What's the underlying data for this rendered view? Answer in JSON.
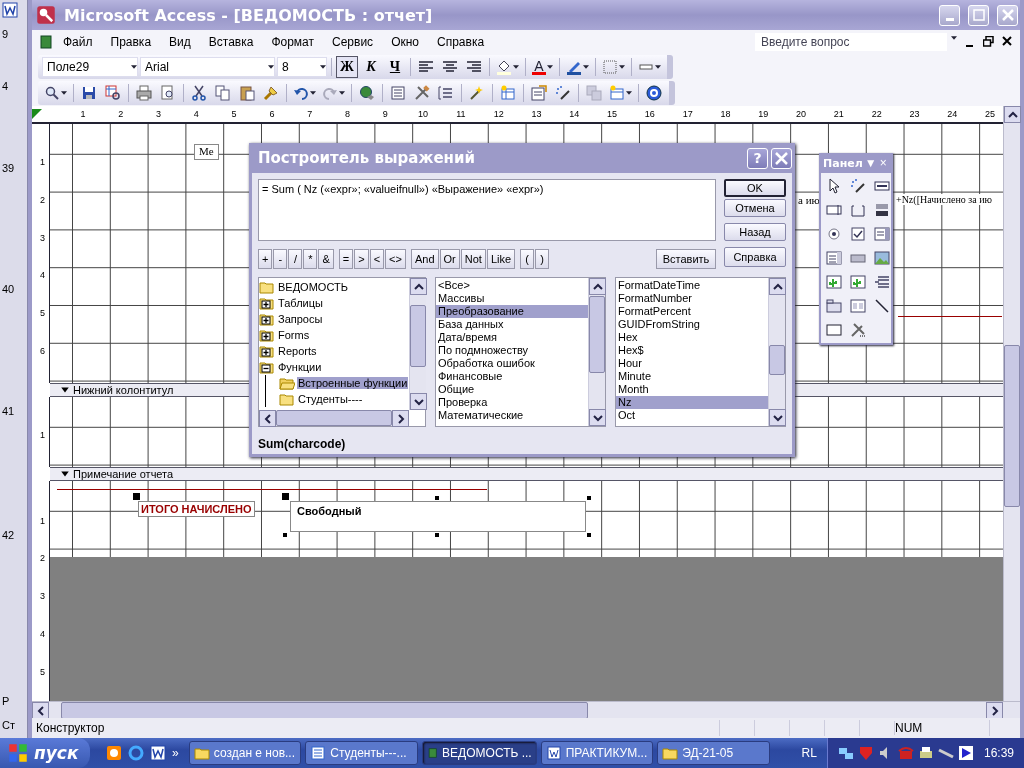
{
  "window": {
    "title": "Microsoft Access - [ВЕДОМОСТЬ : отчет]"
  },
  "menu": [
    "Файл",
    "Правка",
    "Вид",
    "Вставка",
    "Формат",
    "Сервис",
    "Окно",
    "Справка"
  ],
  "help_search": {
    "placeholder": "Введите вопрос"
  },
  "format_toolbar": {
    "control": "Поле29",
    "font": "Arial",
    "size": "8",
    "bold": {
      "label": "Ж",
      "on": true
    },
    "italic": "К",
    "underline": "Ч",
    "font_color": "A"
  },
  "ruler": [
    "1",
    "2",
    "3",
    "4",
    "5",
    "6",
    "7",
    "8",
    "9",
    "10",
    "11",
    "12",
    "13",
    "14",
    "15",
    "16",
    "17",
    "18",
    "19",
    "20",
    "21",
    "22",
    "23",
    "24",
    "25"
  ],
  "detail": {
    "ruler": [
      "1",
      "2",
      "3",
      "4",
      "5",
      "6"
    ],
    "label": "Ме",
    "text_1": "а ию",
    "text_2": "+Nz([Начислено за ию"
  },
  "page_footer": {
    "title": "Нижний колонтитул",
    "ruler": [
      "1"
    ]
  },
  "report_footer": {
    "title": "Примечание отчета",
    "ruler": [
      "1",
      "2",
      "3",
      "4",
      "5"
    ],
    "label": "ИТОГО НАЧИСЛЕНО",
    "textbox": "Свободный"
  },
  "dialog": {
    "title": "Построитель выражений",
    "help": "?",
    "expression": "= Sum ( Nz («expr»; «valueifnull») «Выражение» «expr»)",
    "buttons": [
      "OK",
      "Отмена",
      "Назад",
      "Справка"
    ],
    "insert": "Вставить",
    "operators": [
      "+",
      "-",
      "/",
      "*",
      "&",
      "=",
      ">",
      "<",
      "<>",
      "And",
      "Or",
      "Not",
      "Like",
      "(",
      ")"
    ],
    "tree": [
      {
        "label": "ВЕДОМОСТЬ",
        "selected": false
      },
      {
        "label": "Таблицы",
        "expanded": false,
        "selected": false
      },
      {
        "label": "Запросы",
        "expanded": false,
        "selected": false
      },
      {
        "label": "Forms",
        "expanded": false,
        "selected": false
      },
      {
        "label": "Reports",
        "expanded": false,
        "selected": false
      },
      {
        "label": "Функции",
        "expanded": true,
        "selected": false,
        "children": [
          {
            "label": "Встроенные функции",
            "selected": true
          },
          {
            "label": "Студенты----",
            "selected": false
          }
        ]
      }
    ],
    "categories": [
      {
        "label": "<Все>",
        "selected": false
      },
      {
        "label": "Массивы",
        "selected": false
      },
      {
        "label": "Преобразование",
        "selected": true
      },
      {
        "label": "База данных",
        "selected": false
      },
      {
        "label": "Дата/время",
        "selected": false
      },
      {
        "label": "По подмножеству",
        "selected": false
      },
      {
        "label": "Обработка ошибок",
        "selected": false
      },
      {
        "label": "Финансовые",
        "selected": false
      },
      {
        "label": "Общие",
        "selected": false
      },
      {
        "label": "Проверка",
        "selected": false
      },
      {
        "label": "Математические",
        "selected": false
      }
    ],
    "functions": [
      {
        "label": "FormatDateTime",
        "selected": false
      },
      {
        "label": "FormatNumber",
        "selected": false
      },
      {
        "label": "FormatPercent",
        "selected": false
      },
      {
        "label": "GUIDFromString",
        "selected": false
      },
      {
        "label": "Hex",
        "selected": false
      },
      {
        "label": "Hex$",
        "selected": false
      },
      {
        "label": "Hour",
        "selected": false
      },
      {
        "label": "Minute",
        "selected": false
      },
      {
        "label": "Month",
        "selected": false
      },
      {
        "label": "Nz",
        "selected": true
      },
      {
        "label": "Oct",
        "selected": false
      }
    ],
    "syntax": "Sum(charcode)"
  },
  "toolbox": {
    "title": "Панел",
    "menu": "▼",
    "close": "×"
  },
  "status_bar": {
    "mode": "Конструктор",
    "num": "NUM"
  },
  "taskbar": {
    "start": "пуск",
    "more": "»",
    "tasks": [
      {
        "label": "создан е нов...",
        "kind": "folder",
        "selected": false
      },
      {
        "label": "Студенты---...",
        "kind": "form",
        "selected": false
      },
      {
        "label": "ВЕДОМОСТЬ ...",
        "kind": "access",
        "selected": true
      },
      {
        "label": "ПРАКТИКУМ...",
        "kind": "word",
        "selected": false
      },
      {
        "label": "ЭД-21-05",
        "kind": "folder",
        "selected": false
      }
    ],
    "language": "RL",
    "time": "16:39"
  },
  "background_window": {
    "texts": [
      "9",
      "4",
      "39",
      "40",
      "41",
      "42",
      "Р",
      "Ст"
    ]
  }
}
